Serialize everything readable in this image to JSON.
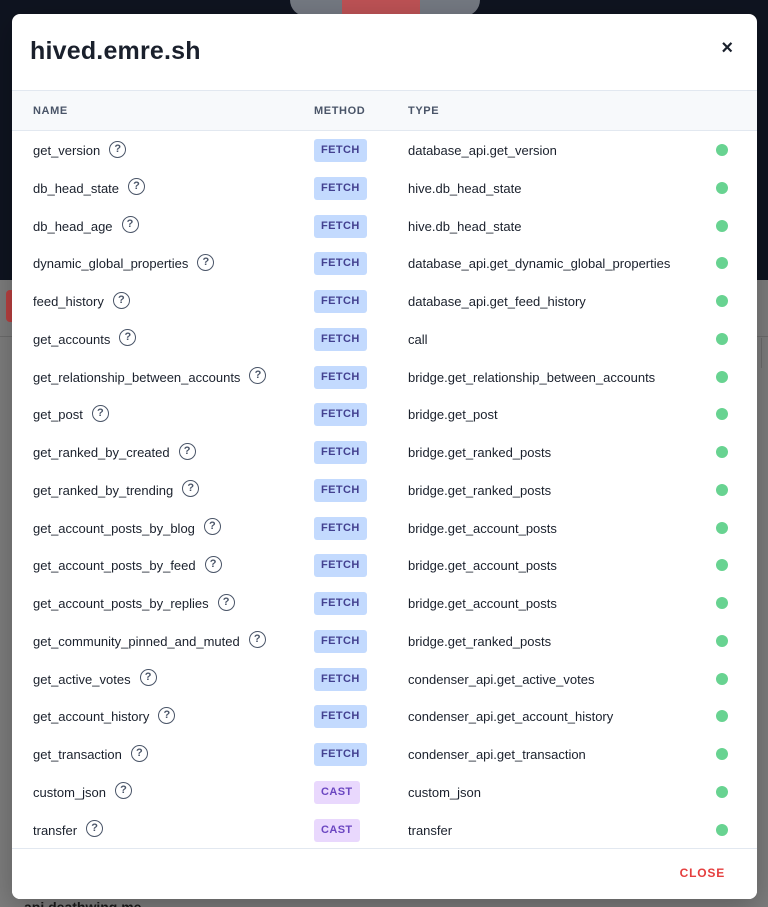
{
  "background": {
    "footer_text": "api.deathwing.me"
  },
  "modal": {
    "title": "hived.emre.sh",
    "close_icon": "×",
    "close_label": "CLOSE",
    "columns": {
      "name": "NAME",
      "method": "METHOD",
      "type": "TYPE"
    },
    "status_color": "#68d391",
    "rows": [
      {
        "name": "get_version",
        "method": "FETCH",
        "type": "database_api.get_version"
      },
      {
        "name": "db_head_state",
        "method": "FETCH",
        "type": "hive.db_head_state"
      },
      {
        "name": "db_head_age",
        "method": "FETCH",
        "type": "hive.db_head_state"
      },
      {
        "name": "dynamic_global_properties",
        "method": "FETCH",
        "type": "database_api.get_dynamic_global_properties"
      },
      {
        "name": "feed_history",
        "method": "FETCH",
        "type": "database_api.get_feed_history"
      },
      {
        "name": "get_accounts",
        "method": "FETCH",
        "type": "call"
      },
      {
        "name": "get_relationship_between_accounts",
        "method": "FETCH",
        "type": "bridge.get_relationship_between_accounts"
      },
      {
        "name": "get_post",
        "method": "FETCH",
        "type": "bridge.get_post"
      },
      {
        "name": "get_ranked_by_created",
        "method": "FETCH",
        "type": "bridge.get_ranked_posts"
      },
      {
        "name": "get_ranked_by_trending",
        "method": "FETCH",
        "type": "bridge.get_ranked_posts"
      },
      {
        "name": "get_account_posts_by_blog",
        "method": "FETCH",
        "type": "bridge.get_account_posts"
      },
      {
        "name": "get_account_posts_by_feed",
        "method": "FETCH",
        "type": "bridge.get_account_posts"
      },
      {
        "name": "get_account_posts_by_replies",
        "method": "FETCH",
        "type": "bridge.get_account_posts"
      },
      {
        "name": "get_community_pinned_and_muted",
        "method": "FETCH",
        "type": "bridge.get_ranked_posts"
      },
      {
        "name": "get_active_votes",
        "method": "FETCH",
        "type": "condenser_api.get_active_votes"
      },
      {
        "name": "get_account_history",
        "method": "FETCH",
        "type": "condenser_api.get_account_history"
      },
      {
        "name": "get_transaction",
        "method": "FETCH",
        "type": "condenser_api.get_transaction"
      },
      {
        "name": "custom_json",
        "method": "CAST",
        "type": "custom_json"
      },
      {
        "name": "transfer",
        "method": "CAST",
        "type": "transfer"
      }
    ]
  }
}
